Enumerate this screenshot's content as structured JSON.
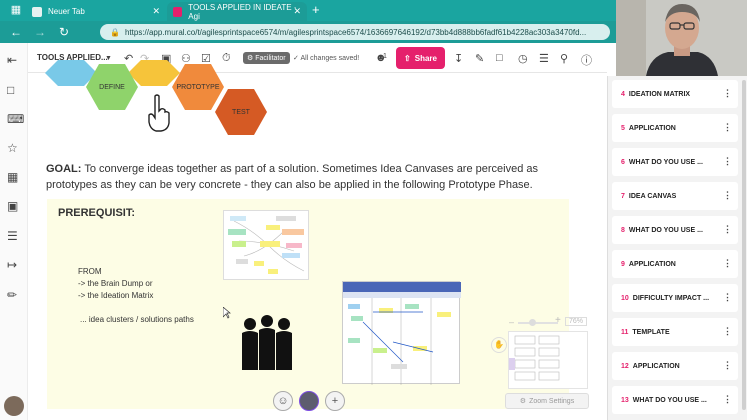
{
  "browser": {
    "tabs": [
      {
        "label": "Neuer Tab",
        "favicon_color": "#e6f2f1"
      },
      {
        "label": "TOOLS APPLIED IN IDEATE · Agi",
        "favicon_color": "#e5206c"
      }
    ],
    "url": "https://app.mural.co/t/agilesprintspace6574/m/agilesprintspace6574/1636697646192/d73bb4d888bb6fadf61b4228ac303a3470fd...",
    "accent": "#1c9c97"
  },
  "toolbar": {
    "board_title": "TOOLS APPLIED...",
    "facilitator_label": "Facilitator",
    "saved_status": "All changes saved!",
    "participants_count": "1",
    "share_label": "Share"
  },
  "canvas": {
    "hexagons": [
      {
        "label": "DEFINE",
        "color": "#8fd36b"
      },
      {
        "label": "PROTOTYPE",
        "color": "#f08a3c"
      },
      {
        "label": "TEST",
        "color": "#d55a24"
      },
      {
        "label": "",
        "color": "#79c9e8"
      },
      {
        "label": "",
        "color": "#f6c43a"
      }
    ],
    "goal_label": "GOAL:",
    "goal_text": "To converge ideas together as part of a solution. Sometimes Idea Canvases are perceived as prototypes as they can be very concrete - they can also be applied in the following Prototype Phase.",
    "prereq_title": "PREREQUISIT:",
    "from_lines": [
      "FROM",
      "-> the Brain Dump or",
      "-> the Ideation Matrix"
    ],
    "clusters_text": "... idea clusters / solutions paths",
    "zoom_percent": "76%",
    "zoom_settings_label": "Zoom Settings"
  },
  "outline": {
    "items": [
      {
        "num": "4",
        "label": "IDEATION MATRIX"
      },
      {
        "num": "5",
        "label": "APPLICATION"
      },
      {
        "num": "6",
        "label": "WHAT DO YOU USE ..."
      },
      {
        "num": "7",
        "label": "IDEA CANVAS"
      },
      {
        "num": "8",
        "label": "WHAT DO YOU USE ..."
      },
      {
        "num": "9",
        "label": "APPLICATION"
      },
      {
        "num": "10",
        "label": "DIFFICULTY IMPACT ..."
      },
      {
        "num": "11",
        "label": "TEMPLATE"
      },
      {
        "num": "12",
        "label": "APPLICATION"
      },
      {
        "num": "13",
        "label": "WHAT DO YOU USE ..."
      }
    ]
  }
}
